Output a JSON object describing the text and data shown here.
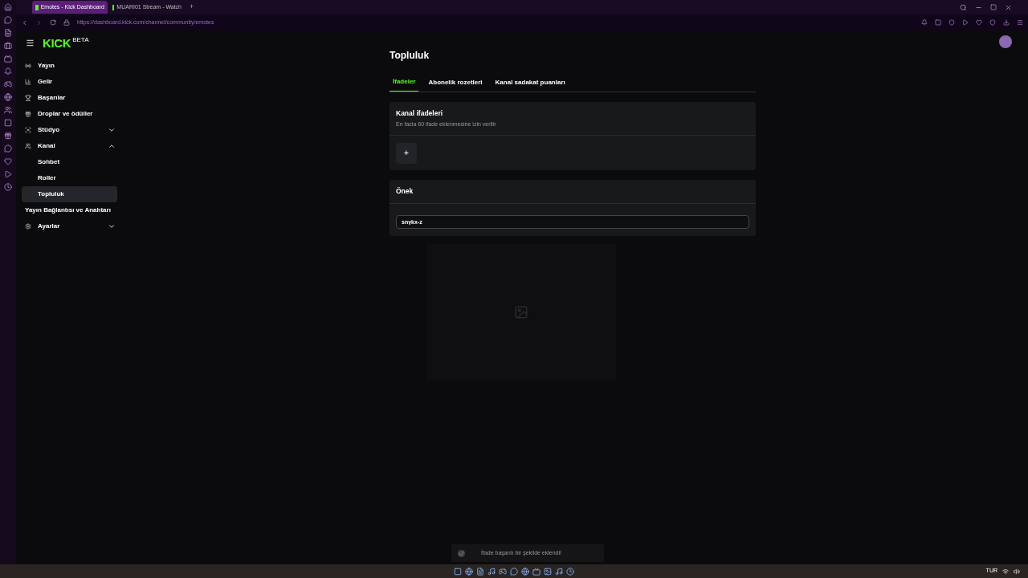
{
  "browser": {
    "tabs": [
      {
        "title": "Emotes - Kick Dashboard",
        "selected": true
      },
      {
        "title": "MUARI01 Stream - Watch",
        "selected": false
      }
    ],
    "new_tab": "+",
    "url": "https://dashboard.kick.com/channel/community/emotes"
  },
  "logo": "KICK",
  "logo_badge": "BETA",
  "sidebar": {
    "items": [
      {
        "label": "Yayın",
        "selected": false
      },
      {
        "label": "Gelir",
        "selected": false
      },
      {
        "label": "Başarılar",
        "selected": false
      },
      {
        "label": "Droplar ve ödüller",
        "selected": false
      },
      {
        "label": "Stüdyo",
        "selected": false,
        "expanded": false
      },
      {
        "label": "Kanal",
        "selected": false,
        "expanded": true,
        "children": [
          {
            "label": "Sohbet",
            "selected": false
          },
          {
            "label": "Roller",
            "selected": false
          },
          {
            "label": "Topluluk",
            "selected": true
          }
        ]
      },
      {
        "label": "Yayın Bağlantısı ve Anahtarı",
        "selected": false
      },
      {
        "label": "Ayarlar",
        "selected": false,
        "expanded": false
      }
    ]
  },
  "page": {
    "title": "Topluluk",
    "tabs": [
      {
        "label": "İfadeler",
        "selected": true
      },
      {
        "label": "Abonelik rozetleri",
        "selected": false
      },
      {
        "label": "Kanal sadakat puanları",
        "selected": false
      }
    ],
    "emotes_card": {
      "title": "Kanal ifadeleri",
      "subtitle": "En fazla 60 ifade eklenmesine izin verilir",
      "add": "+"
    },
    "prefix_card": {
      "title": "Önek",
      "value": "snykx-z"
    }
  },
  "toast": "İfade başarılı bir şekilde eklendi!",
  "taskbar": {
    "lang": "TUR"
  }
}
